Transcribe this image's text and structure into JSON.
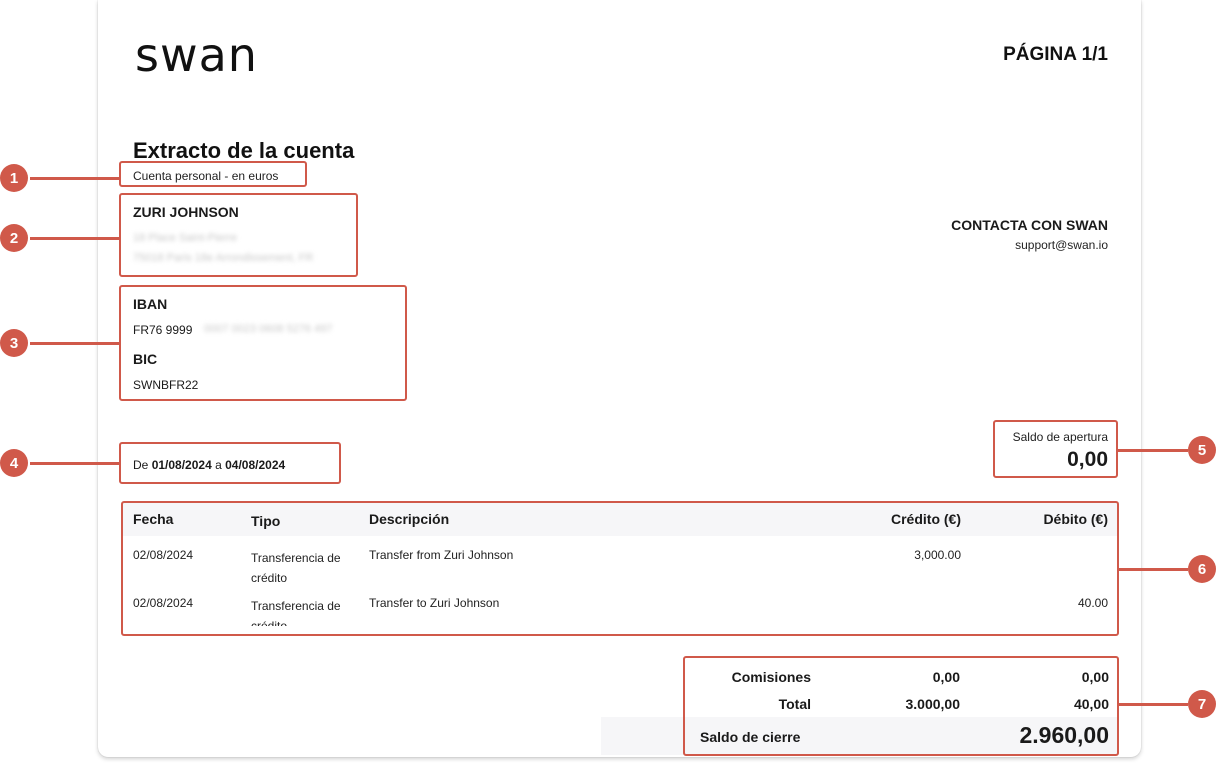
{
  "header": {
    "logo": "swan",
    "page": "PÁGINA 1/1"
  },
  "statement": {
    "title": "Extracto de la cuenta",
    "subtitle": "Cuenta personal - en euros"
  },
  "holder": {
    "name": "ZURI JOHNSON",
    "address_line1": "18 Place Saint-Pierre",
    "address_line2": "75018 Paris 18e Arrondissement, FR"
  },
  "contact": {
    "title": "CONTACTA CON SWAN",
    "email": "support@swan.io"
  },
  "account": {
    "iban_label": "IBAN",
    "iban_visible": "FR76 9999",
    "iban_hidden": "0007 0023 0608 5276 497",
    "bic_label": "BIC",
    "bic_value": "SWNBFR22"
  },
  "period": {
    "prefix": "De",
    "from": "01/08/2024",
    "joiner": "a",
    "to": "04/08/2024"
  },
  "opening": {
    "label": "Saldo de apertura",
    "value": "0,00"
  },
  "table": {
    "headers": {
      "fecha": "Fecha",
      "tipo": "Tipo",
      "descripcion": "Descripción",
      "credito": "Crédito (€)",
      "debito": "Débito (€)"
    },
    "rows": [
      {
        "fecha": "02/08/2024",
        "tipo": "Transferencia de crédito",
        "descripcion": "Transfer from Zuri Johnson",
        "credito": "3,000.00",
        "debito": ""
      },
      {
        "fecha": "02/08/2024",
        "tipo": "Transferencia de crédito",
        "descripcion": "Transfer to Zuri Johnson",
        "credito": "",
        "debito": "40.00"
      }
    ]
  },
  "totals": {
    "comisiones_label": "Comisiones",
    "comisiones_credito": "0,00",
    "comisiones_debito": "0,00",
    "total_label": "Total",
    "total_credito": "3.000,00",
    "total_debito": "40,00",
    "closing_label": "Saldo de cierre",
    "closing_value": "2.960,00"
  },
  "annotations": [
    "1",
    "2",
    "3",
    "4",
    "5",
    "6",
    "7"
  ],
  "colors": {
    "annotation": "#d0594a",
    "table_header_bg": "#f6f6f8"
  }
}
